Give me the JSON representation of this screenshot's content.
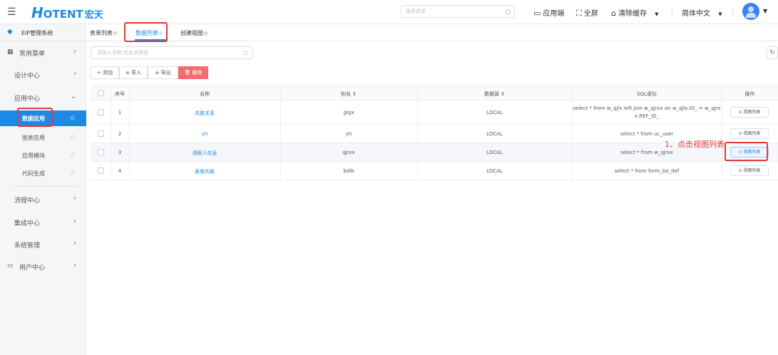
{
  "header": {
    "menu_icon": "hamburger-icon",
    "logo_big": "H",
    "logo_rest": "OTENT",
    "logo_cn": "宏天",
    "search_placeholder": "搜索菜单",
    "app_end": "应用端",
    "fullscreen": "全屏",
    "clear_cache": "清除缓存",
    "language": "简体中文"
  },
  "sidebar": {
    "system_name": "EIP管理系统",
    "items": [
      {
        "label": "常用菜单"
      },
      {
        "label": "设计中心"
      },
      {
        "label": "应用中心"
      },
      {
        "label": "流程中心"
      },
      {
        "label": "集成中心"
      },
      {
        "label": "系统管理"
      },
      {
        "label": "用户中心"
      }
    ],
    "subitems": [
      {
        "label": "数据应用"
      },
      {
        "label": "图表应用"
      },
      {
        "label": "应用模块"
      },
      {
        "label": "代码生成"
      }
    ]
  },
  "tabs": [
    {
      "label": "表单列表☆"
    },
    {
      "label": "数据列表☆"
    },
    {
      "label": "创建视图☆"
    }
  ],
  "search": {
    "placeholder": "请输入名称,别名来搜索"
  },
  "toolbar": {
    "add": "+ 添加",
    "import": "± 导入",
    "export": "± 导出",
    "delete": "🗑 删除"
  },
  "table": {
    "columns": [
      "序号",
      "名称",
      "别名 ⇕",
      "数据源 ⇕",
      "SQL语句",
      "操作"
    ],
    "rows": [
      {
        "index": "1",
        "name": "关联关系",
        "alias": "glgx",
        "source": "LOCAL",
        "sql_line1": "select * from w_qjlx left join w_qjrxx on w_qjlx.ID_ = w_qjrx",
        "sql_line2": "x.REF_ID_",
        "action": "⊙ 视图列表"
      },
      {
        "index": "2",
        "name": "yh",
        "alias": "yh",
        "source": "LOCAL",
        "sql_line1": "select * from uc_user",
        "sql_line2": "",
        "action": "⊙ 视图列表"
      },
      {
        "index": "3",
        "name": "请假人信息",
        "alias": "qjrxx",
        "source": "LOCAL",
        "sql_line1": "select * from w_qjrxx",
        "sql_line2": "",
        "action": "⊙ 视图列表"
      },
      {
        "index": "4",
        "name": "表单列表",
        "alias": "bdlb",
        "source": "LOCAL",
        "sql_line1": "select * from form_bo_def",
        "sql_line2": "",
        "action": "⊙ 视图列表"
      }
    ]
  },
  "annotation": "1、点击视图列表"
}
